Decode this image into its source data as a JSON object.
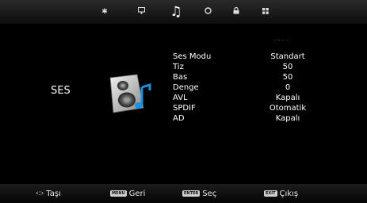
{
  "top_menu": {
    "tabs": [
      {
        "icon": "gear-icon",
        "active": false
      },
      {
        "icon": "monitor-icon",
        "active": false
      },
      {
        "icon": "music-note-icon",
        "active": true
      },
      {
        "icon": "clock-icon",
        "active": false
      },
      {
        "icon": "lock-icon",
        "active": false
      },
      {
        "icon": "grid-icon",
        "active": false
      }
    ]
  },
  "section": {
    "title": "SES",
    "icon": "speaker-icon"
  },
  "scroll_indicator": "......",
  "settings": [
    {
      "label": "Ses Modu",
      "value": "Standart"
    },
    {
      "label": "Tiz",
      "value": "50"
    },
    {
      "label": "Bas",
      "value": "50"
    },
    {
      "label": "Denge",
      "value": "0"
    },
    {
      "label": "AVL",
      "value": "Kapalı"
    },
    {
      "label": "SPDIF",
      "value": "Otomatik"
    },
    {
      "label": "AD",
      "value": "Kapalı"
    }
  ],
  "footer": {
    "move": {
      "icon": "arrows-icon",
      "label": "Taşı"
    },
    "back": {
      "key": "MENU",
      "label": "Geri"
    },
    "select": {
      "key": "ENTER",
      "label": "Seç"
    },
    "exit": {
      "key": "EXIT",
      "label": "Çıkış"
    }
  },
  "colors": {
    "background": "#000000",
    "text": "#ffffff",
    "accent": "#1e90e0"
  }
}
